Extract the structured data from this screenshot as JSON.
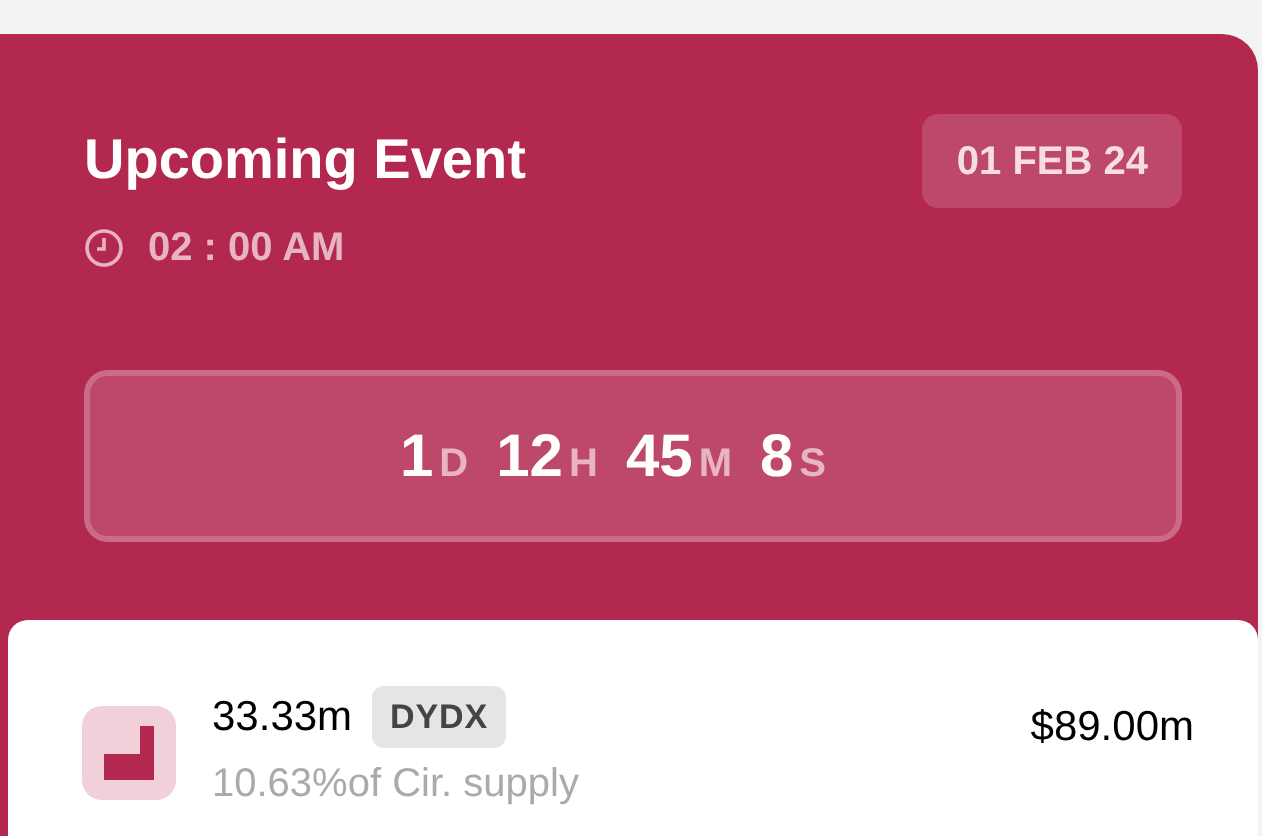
{
  "event": {
    "title": "Upcoming Event",
    "time": "02 : 00 AM",
    "date": "01 FEB 24",
    "countdown": [
      {
        "value": "1",
        "unit": "D"
      },
      {
        "value": "12",
        "unit": "H"
      },
      {
        "value": "45",
        "unit": "M"
      },
      {
        "value": "8",
        "unit": "S"
      }
    ]
  },
  "unlock": {
    "amount": "33.33m",
    "token": "DYDX",
    "supply": "10.63%of Cir. supply",
    "value": "$89.00m"
  }
}
